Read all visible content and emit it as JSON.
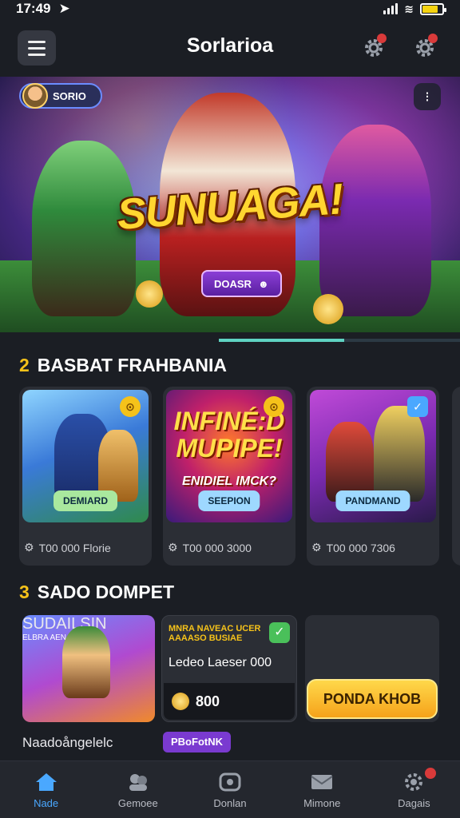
{
  "status": {
    "time": "17:49"
  },
  "header": {
    "title": "Sorlarioa"
  },
  "hero": {
    "title": "SUNUAGA!",
    "tag_label": "DOASR",
    "profile_label": "SORIO",
    "progress": 0.52
  },
  "section1": {
    "number": "2",
    "title": "BASBAT FRAHBANIA",
    "cards": [
      {
        "cta": "DEMIARD",
        "meta": "T00 000 Florie",
        "badge": "gold"
      },
      {
        "art_title": "INFINÉ:D MUPIPE!",
        "art_subtitle": "ENIDIEL IMCK?",
        "cta": "SEEPION",
        "meta": "T00 000 3000",
        "badge": "gold"
      },
      {
        "cta": "PANDMAND",
        "meta": "T00 000 7306",
        "badge": "check"
      }
    ]
  },
  "section2": {
    "number": "3",
    "title": "SADO DOMPET",
    "card1": {
      "art_title": "SUDAILSIN",
      "art_subtitle": "ELBRA AEN",
      "caption": "Naadoångelelc"
    },
    "card2": {
      "heading": "MNRA NAVEAC UCER AAAASO BUSIAE",
      "line": "Ledeo Laeser 000",
      "coins": "800",
      "tag": "PBoFotNK"
    },
    "card3": {
      "button_label": "PONDA KHOB"
    }
  },
  "nav": {
    "items": [
      {
        "label": "Nade",
        "icon": "home-icon",
        "active": true
      },
      {
        "label": "Gemoee",
        "icon": "social-icon",
        "active": false
      },
      {
        "label": "Donlan",
        "icon": "download-icon",
        "active": false
      },
      {
        "label": "Mimone",
        "icon": "inbox-icon",
        "active": false
      },
      {
        "label": "Dagais",
        "icon": "settings-icon",
        "active": false
      }
    ]
  },
  "colors": {
    "accent": "#4aa8ff",
    "gold": "#f5c21a",
    "background": "#1b1e24"
  }
}
